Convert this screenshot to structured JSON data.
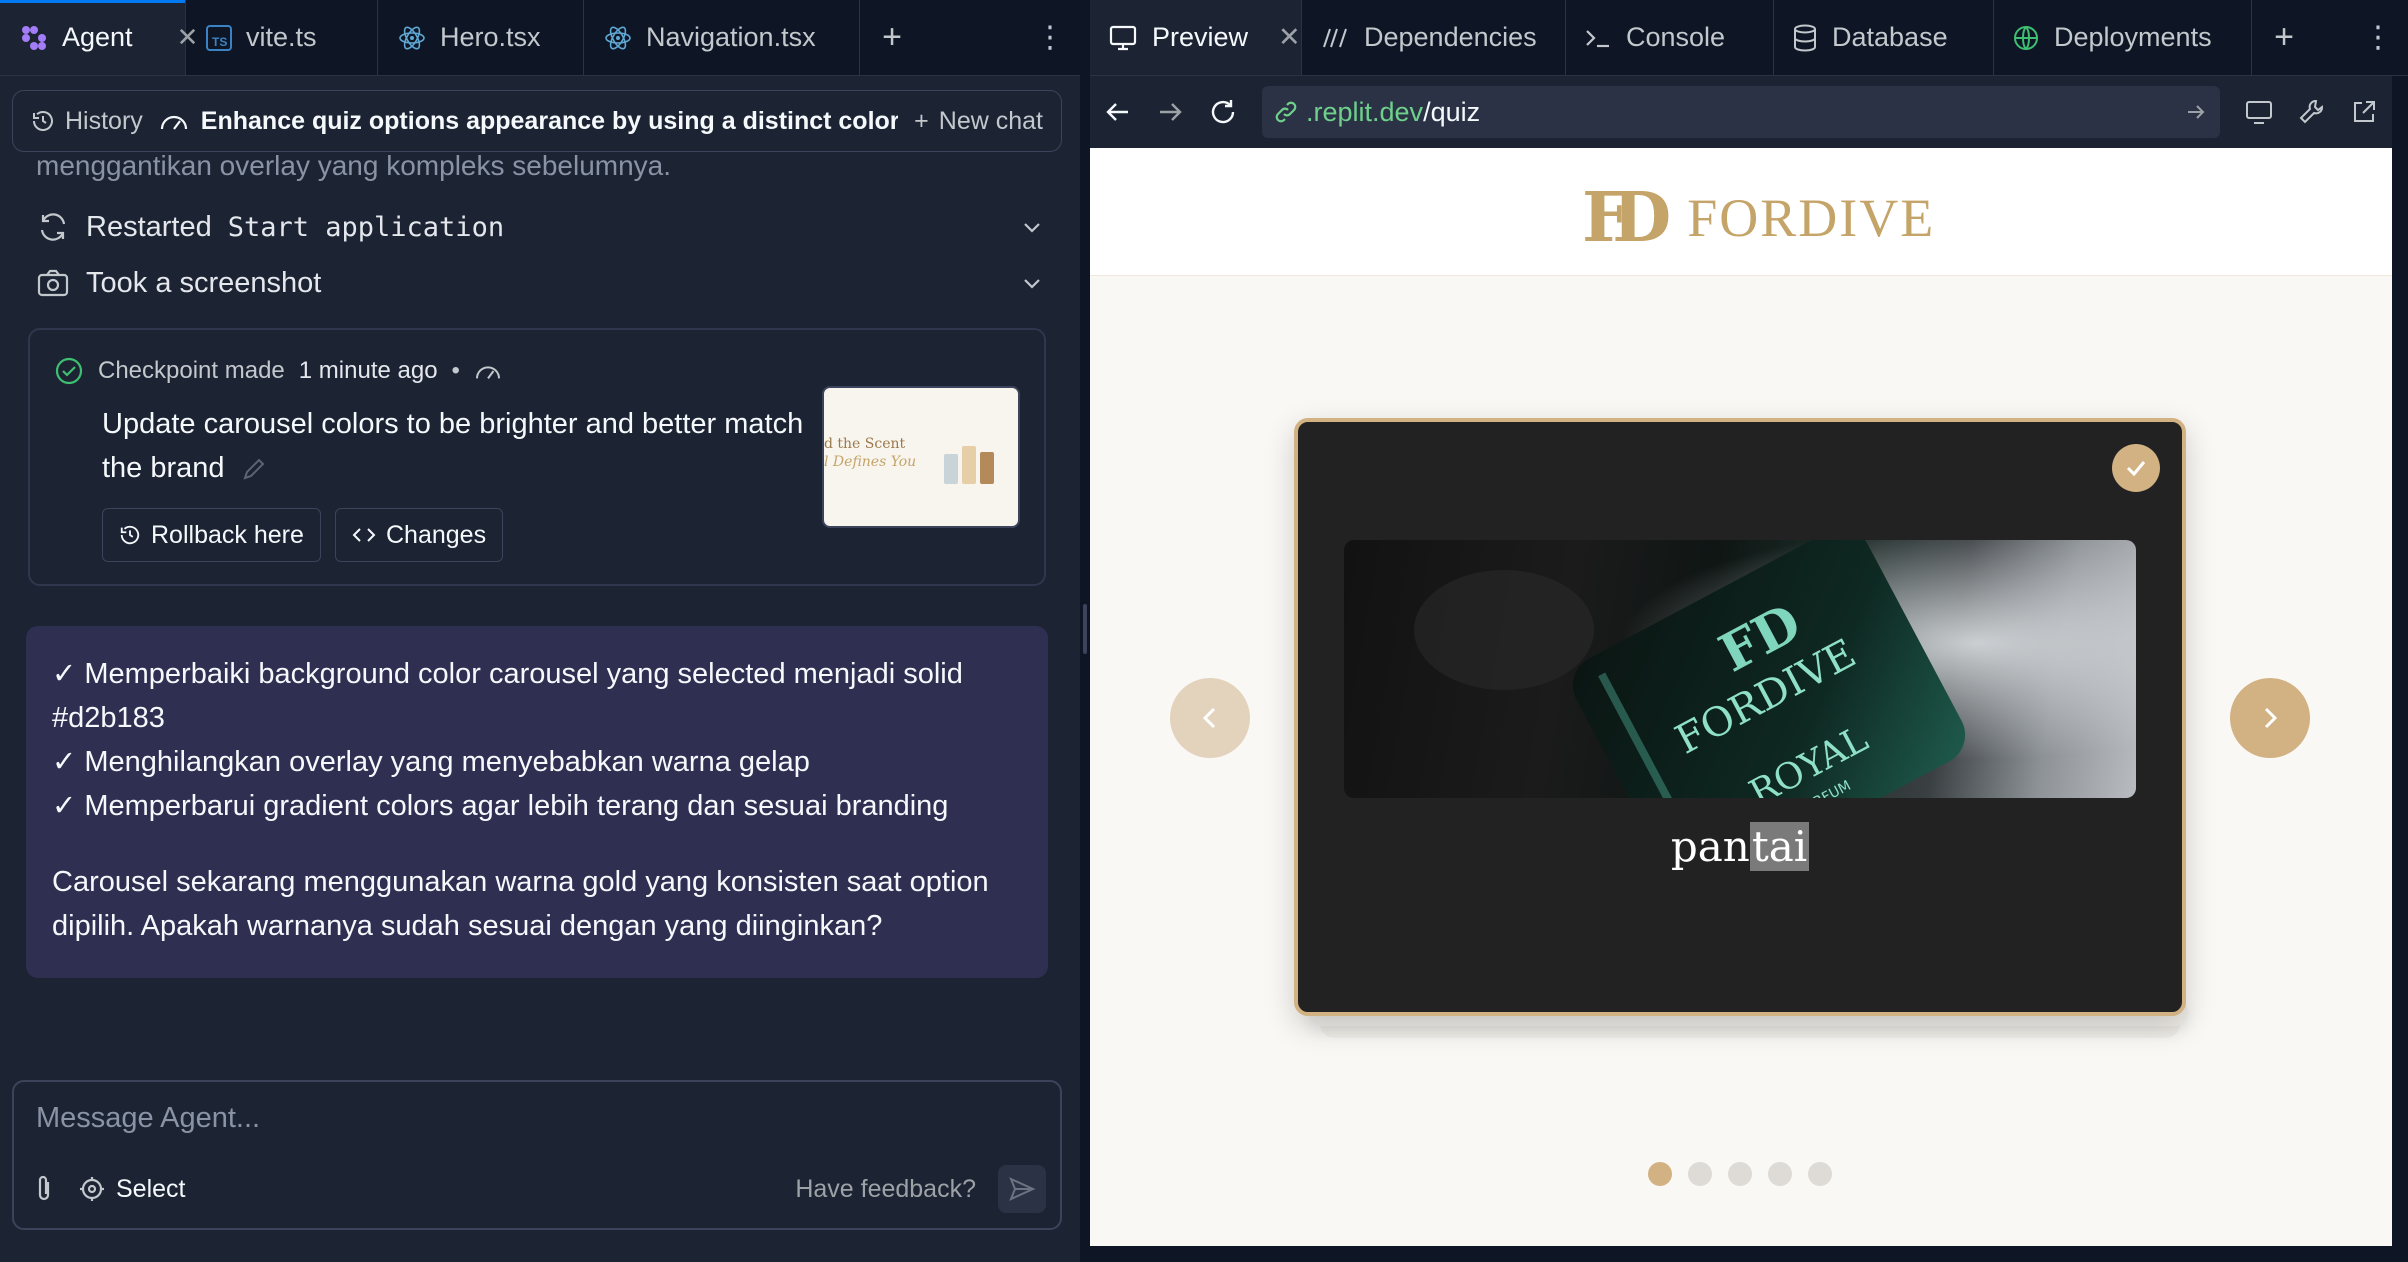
{
  "left_tabs": {
    "agent": "Agent",
    "vite": "vite.ts",
    "hero": "Hero.tsx",
    "navigation": "Navigation.tsx"
  },
  "chat_header": {
    "history": "History",
    "title": "Enhance quiz options appearance by using a distinct color a...",
    "new_chat": "New chat"
  },
  "conversation": {
    "faded_text": "menggantikan overlay yang kompleks sebelumnya.",
    "actions": [
      {
        "prefix": "Restarted",
        "mono": "Start application"
      },
      {
        "prefix": "Took a screenshot",
        "mono": ""
      }
    ],
    "checkpoint": {
      "meta_label": "Checkpoint made",
      "time": "1 minute ago",
      "separator": "•",
      "title": "Update carousel colors to be brighter and better match the brand",
      "rollback": "Rollback here",
      "changes": "Changes",
      "thumb_text_1": "d the Scent",
      "thumb_text_2": "l Defines You"
    },
    "message": {
      "lines": [
        "✓ Memperbaiki background color carousel yang selected menjadi solid #d2b183",
        "✓ Menghilangkan overlay yang menyebabkan warna gelap",
        "✓ Memperbarui gradient colors agar lebih terang dan sesuai branding"
      ],
      "paragraph": "Carousel sekarang menggunakan warna gold yang konsisten saat option dipilih. Apakah warnanya sudah sesuai dengan yang diinginkan?"
    }
  },
  "composer": {
    "placeholder": "Message Agent...",
    "select": "Select",
    "feedback": "Have feedback?"
  },
  "right_tabs": {
    "preview": "Preview",
    "dependencies": "Dependencies",
    "console": "Console",
    "database": "Database",
    "deployments": "Deployments"
  },
  "urlbar": {
    "domain": ".replit.dev",
    "path": "/quiz"
  },
  "site": {
    "logo_mark": "FD",
    "logo_text": "FORDIVE",
    "card_label_a": "pan",
    "card_label_b": "tai",
    "bottle_brand": "FORDIVE",
    "bottle_line": "ROYAL",
    "bottle_sub": "DE PARFUM",
    "carousel_dots": 5,
    "active_dot": 1
  },
  "colors": {
    "accent_gold": "#d2b183",
    "card_bg": "#222222",
    "message_bg": "#2f2f52",
    "ide_bg": "#1c2333"
  }
}
